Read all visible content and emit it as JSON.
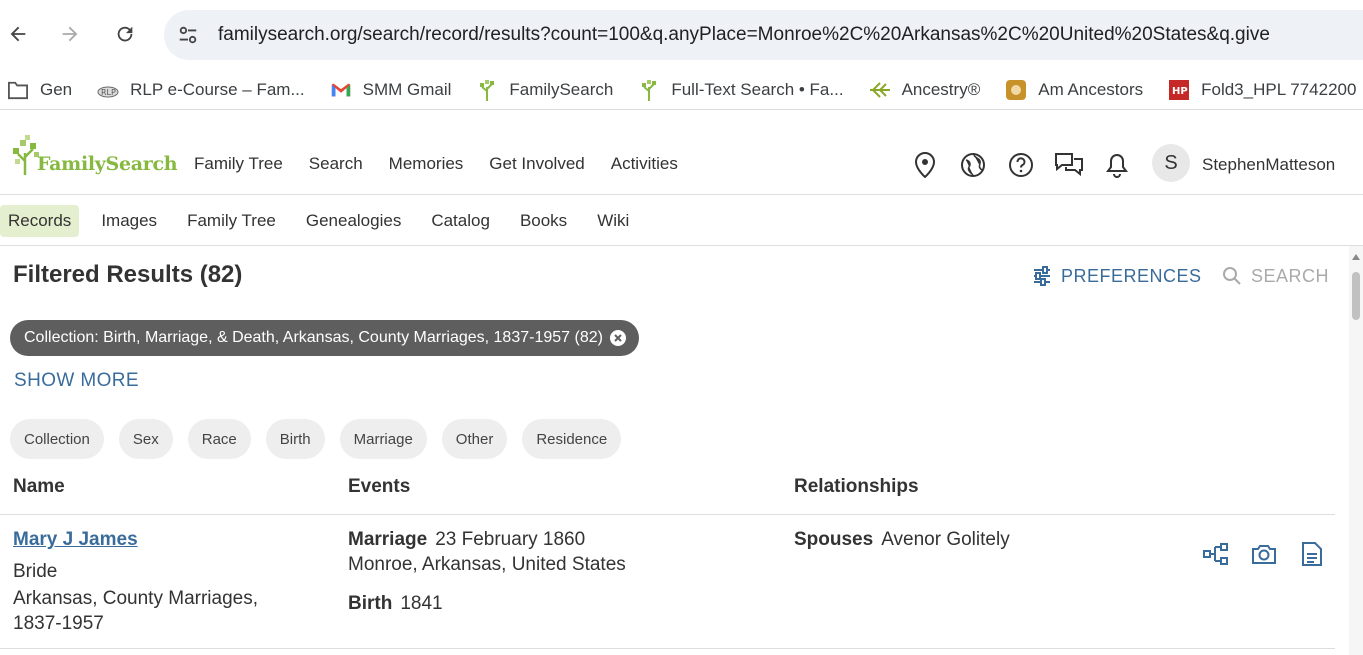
{
  "browser": {
    "url": "familysearch.org/search/record/results?count=100&q.anyPlace=Monroe%2C%20Arkansas%2C%20United%20States&q.give",
    "bookmarks": [
      {
        "label": "Gen",
        "icon": "folder-icon"
      },
      {
        "label": "RLP e-Course – Fam...",
        "icon": "rlp-icon"
      },
      {
        "label": "SMM Gmail",
        "icon": "gmail-icon"
      },
      {
        "label": "FamilySearch",
        "icon": "familysearch-tree-icon"
      },
      {
        "label": "Full-Text Search • Fa...",
        "icon": "familysearch-tree-icon"
      },
      {
        "label": "Ancestry®",
        "icon": "ancestry-leaf-icon"
      },
      {
        "label": "Am Ancestors",
        "icon": "am-ancestors-icon"
      },
      {
        "label": "Fold3_HPL  7742200",
        "icon": "fold3-icon"
      }
    ]
  },
  "header": {
    "logo_text": "FamilySearch",
    "nav": [
      "Family Tree",
      "Search",
      "Memories",
      "Get Involved",
      "Activities"
    ],
    "avatar_initial": "S",
    "username": "StephenMatteson"
  },
  "subnav": {
    "items": [
      "Records",
      "Images",
      "Family Tree",
      "Genealogies",
      "Catalog",
      "Books",
      "Wiki"
    ],
    "active": "Records"
  },
  "results": {
    "title": "Filtered Results (82)",
    "preferences_label": "PREFERENCES",
    "search_label": "SEARCH",
    "active_filter": "Collection: Birth, Marriage, & Death, Arkansas, County Marriages, 1837-1957 (82)",
    "show_more": "SHOW MORE",
    "facets": [
      "Collection",
      "Sex",
      "Race",
      "Birth",
      "Marriage",
      "Other",
      "Residence"
    ],
    "columns": {
      "name": "Name",
      "events": "Events",
      "relationships": "Relationships"
    },
    "rows": [
      {
        "name": "Mary J James",
        "role": "Bride",
        "collection": "Arkansas, County Marriages, 1837-1957",
        "event1_label": "Marriage",
        "event1_date": "23 February 1860",
        "event1_place": "Monroe, Arkansas, United States",
        "event2_label": "Birth",
        "event2_date": "1841",
        "rel_label": "Spouses",
        "rel_value": "Avenor Golitely"
      }
    ]
  },
  "colors": {
    "link": "#3a6c9b",
    "brand_green": "#87b940",
    "active_tab_bg": "#e4efcf",
    "chip_bg": "#5e5e5e"
  }
}
